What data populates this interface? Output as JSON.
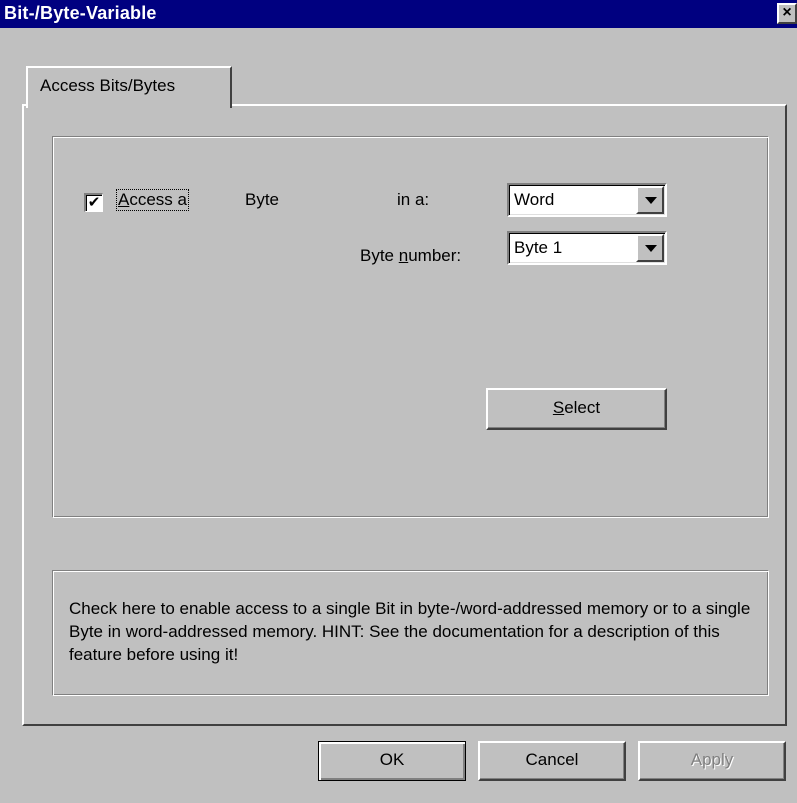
{
  "window": {
    "title": "Bit-/Byte-Variable",
    "close_glyph": "×"
  },
  "tabs": [
    {
      "label": "Access Bits/Bytes",
      "active": true
    }
  ],
  "access": {
    "checkbox_checked": true,
    "checkbox_glyph": "✔",
    "access_label_underlined": "A",
    "access_label_rest": "ccess a",
    "unit_label": "Byte",
    "in_a_label": "in a:",
    "container_value": "Word",
    "byte_number_label_pre": "Byte ",
    "byte_number_label_underlined": "n",
    "byte_number_label_post": "umber:",
    "byte_number_value": "Byte 1",
    "select_button_underlined": "S",
    "select_button_rest": "elect"
  },
  "hint": {
    "text": "Check here to enable access to a single Bit in byte-/word-addressed memory or to a single Byte in word-addressed memory. HINT: See the documentation for a description of this feature before using it!"
  },
  "buttons": {
    "ok": "OK",
    "cancel": "Cancel",
    "apply": "Apply",
    "apply_enabled": false
  },
  "colors": {
    "titlebar": "#000080",
    "face": "#c0c0c0",
    "disabled_text": "#808080"
  }
}
